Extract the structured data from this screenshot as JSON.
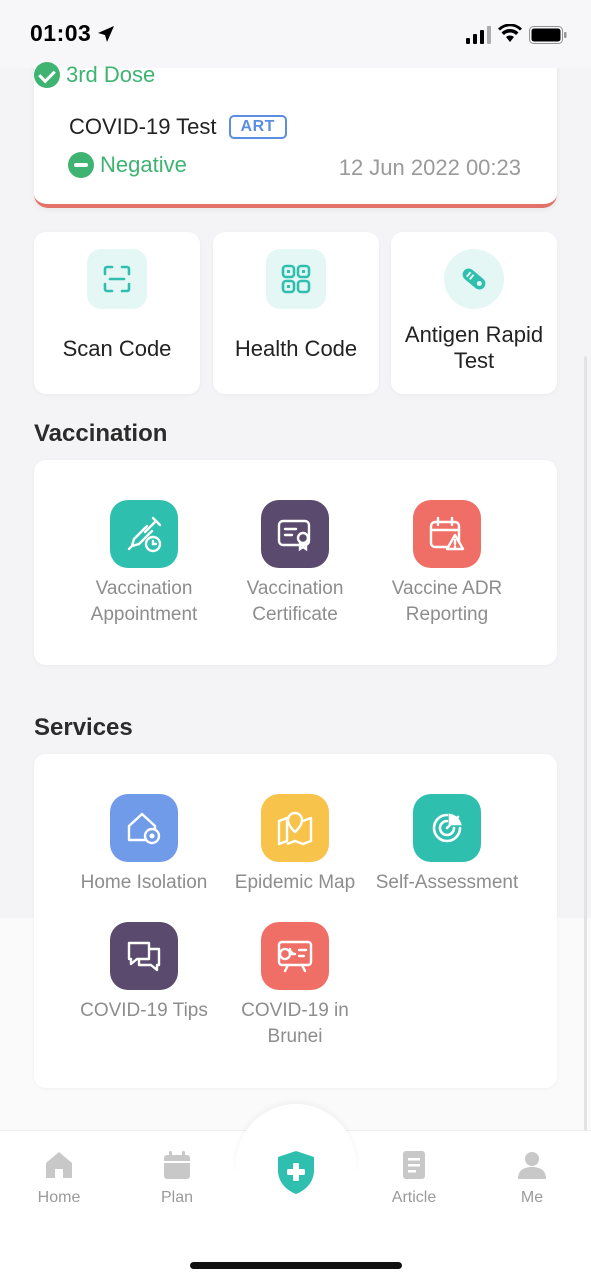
{
  "status_bar": {
    "time": "01:03"
  },
  "status_card": {
    "dose_label": "3rd Dose",
    "test_title": "COVID-19 Test",
    "test_badge": "ART",
    "result": "Negative",
    "timestamp": "12 Jun 2022 00:23",
    "accent": "#e2736a",
    "success_color": "#3fb371"
  },
  "quick_actions": [
    {
      "label": "Scan Code",
      "icon": "scan-icon"
    },
    {
      "label": "Health Code",
      "icon": "qr-code-icon"
    },
    {
      "label": "Antigen Rapid Test",
      "icon": "test-kit-icon"
    }
  ],
  "vaccination": {
    "title": "Vaccination",
    "items": [
      {
        "label": "Vaccination Appointment",
        "icon": "syringe-clock-icon",
        "color": "#2fbfae"
      },
      {
        "label": "Vaccination Certificate",
        "icon": "certificate-icon",
        "color": "#5a4a6e"
      },
      {
        "label": "Vaccine ADR Reporting",
        "icon": "calendar-warning-icon",
        "color": "#ef6f66"
      }
    ]
  },
  "services": {
    "title": "Services",
    "items": [
      {
        "label": "Home Isolation",
        "icon": "home-gear-icon",
        "color": "#6f9be8"
      },
      {
        "label": "Epidemic Map",
        "icon": "map-pin-icon",
        "color": "#f7c34b"
      },
      {
        "label": "Self-Assessment",
        "icon": "radar-icon",
        "color": "#2fbfae"
      },
      {
        "label": "COVID-19 Tips",
        "icon": "chat-bubbles-icon",
        "color": "#5a4a6e"
      },
      {
        "label": "COVID-19 in Brunei",
        "icon": "presentation-chart-icon",
        "color": "#ef6f66"
      }
    ]
  },
  "tab_bar": {
    "tabs": [
      {
        "label": "Home",
        "icon": "home-icon"
      },
      {
        "label": "Plan",
        "icon": "calendar-icon"
      },
      {
        "label": "",
        "icon": "shield-plus-icon"
      },
      {
        "label": "Article",
        "icon": "document-icon"
      },
      {
        "label": "Me",
        "icon": "person-icon"
      }
    ],
    "accent": "#2fbfae"
  }
}
